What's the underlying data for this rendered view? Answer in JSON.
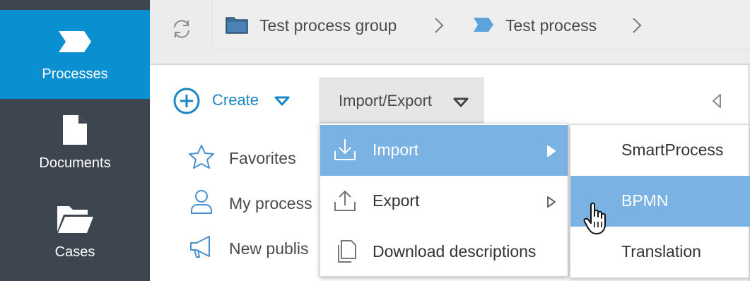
{
  "sidebar": {
    "items": [
      {
        "label": "Processes",
        "icon": "process-chevron-icon",
        "active": true
      },
      {
        "label": "Documents",
        "icon": "document-icon",
        "active": false
      },
      {
        "label": "Cases",
        "icon": "folder-open-icon",
        "active": false
      }
    ]
  },
  "header": {
    "refresh_icon": "refresh-icon",
    "breadcrumb": [
      {
        "label": "Test process group",
        "icon": "folder-icon"
      },
      {
        "label": "Test process",
        "icon": "process-chevron-icon"
      }
    ]
  },
  "toolbar": {
    "create_label": "Create",
    "import_export_label": "Import/Export"
  },
  "nav": {
    "items": [
      {
        "label": "Favorites",
        "icon": "star-icon"
      },
      {
        "label": "My process",
        "icon": "user-icon"
      },
      {
        "label": "New publis",
        "icon": "megaphone-icon"
      }
    ]
  },
  "import_export_menu": {
    "items": [
      {
        "label": "Import",
        "icon": "download-tray-icon",
        "highlighted": true,
        "has_submenu": true
      },
      {
        "label": "Export",
        "icon": "upload-tray-icon",
        "highlighted": false,
        "has_submenu": true
      },
      {
        "label": "Download descriptions",
        "icon": "copy-document-icon",
        "highlighted": false,
        "has_submenu": false
      }
    ]
  },
  "import_submenu": {
    "items": [
      {
        "label": "SmartProcess",
        "highlighted": false
      },
      {
        "label": "BPMN",
        "highlighted": true
      },
      {
        "label": "Translation",
        "highlighted": false
      }
    ]
  },
  "colors": {
    "sidebar_bg": "#3d4650",
    "sidebar_active": "#0a8fd0",
    "accent": "#1b86c5",
    "menu_highlight": "#7ab2e3",
    "header_bg": "#ececec"
  }
}
